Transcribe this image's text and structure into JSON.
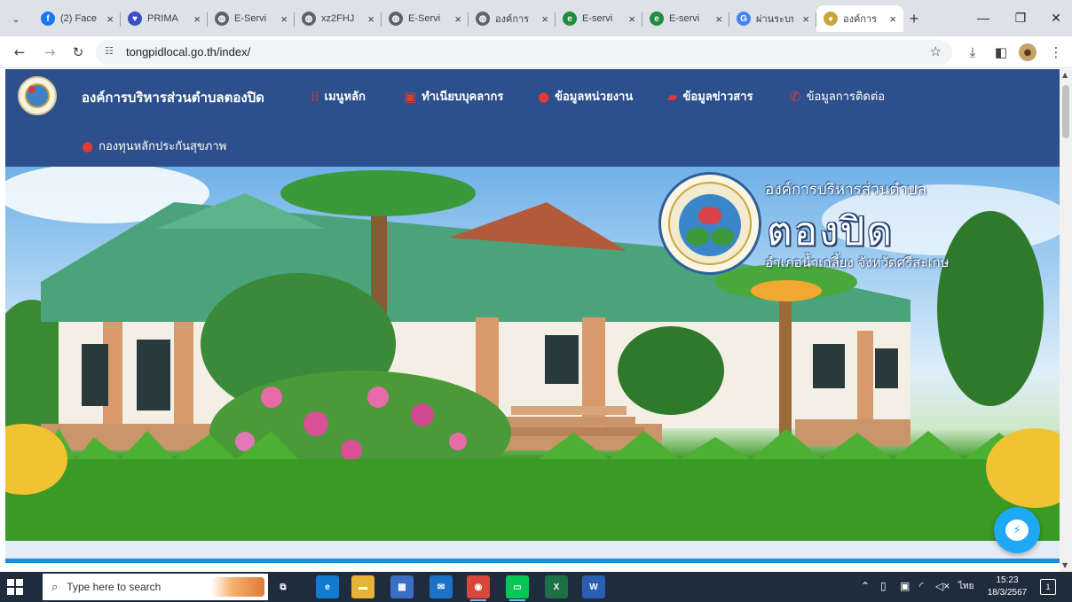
{
  "browser": {
    "tabs": [
      {
        "title": "(2) Face",
        "icon": "facebook-icon",
        "color": "#1877f2",
        "glyph": "f"
      },
      {
        "title": "PRIMA",
        "icon": "prima-icon",
        "color": "#3b4fc4",
        "glyph": "♥"
      },
      {
        "title": "E-Servi",
        "icon": "globe-icon",
        "color": "#5f6368",
        "glyph": "◍"
      },
      {
        "title": "xz2FHJ",
        "icon": "globe-icon",
        "color": "#5f6368",
        "glyph": "◍"
      },
      {
        "title": "E-Servi",
        "icon": "globe-icon",
        "color": "#5f6368",
        "glyph": "◍"
      },
      {
        "title": "องค์การ",
        "icon": "globe-icon",
        "color": "#5f6368",
        "glyph": "◍"
      },
      {
        "title": "E-servi",
        "icon": "eservice-icon",
        "color": "#1e8e3e",
        "glyph": "e"
      },
      {
        "title": "E-servi",
        "icon": "eservice-icon",
        "color": "#1e8e3e",
        "glyph": "e"
      },
      {
        "title": "ผ่านระบบ",
        "icon": "google-icon",
        "color": "#4285f4",
        "glyph": "G"
      },
      {
        "title": "องค์การ",
        "icon": "site-logo-icon",
        "color": "#c9a63d",
        "glyph": "●"
      }
    ],
    "tab_close": "×",
    "new_tab": "+",
    "url": "tongpidlocal.go.th/index/"
  },
  "site": {
    "name": "องค์การบริหารส่วนตำบลตองปิด",
    "menu": [
      {
        "label": "เมนูหลัก",
        "icon": "menu-grid-icon",
        "glyph": "⁞⁞"
      },
      {
        "label": "ทำเนียบบุคลากร",
        "icon": "calendar-icon",
        "glyph": "▣"
      },
      {
        "label": "ข้อมูลหน่วยงาน",
        "icon": "info-circle-icon",
        "glyph": "●"
      },
      {
        "label": "ข้อมูลข่าวสาร",
        "icon": "news-chat-icon",
        "glyph": "▰"
      },
      {
        "label": "ข้อมูลการติดต่อ",
        "icon": "phone-icon",
        "glyph": "✆"
      },
      {
        "label": "กองทุนหลักประกันสุขภาพ",
        "icon": "health-circle-icon",
        "glyph": "●"
      }
    ]
  },
  "hero": {
    "org_line": "องค์การบริหารส่วนตำบล",
    "name": "ตองปิด",
    "district": "อำเภอน้ำเกลี้ยง จังหวัดศรีสะเกษ"
  },
  "taskbar": {
    "search_placeholder": "Type here to search",
    "apps": [
      {
        "name": "task-view-icon",
        "glyph": "⧉",
        "color": "transparent"
      },
      {
        "name": "edge-icon",
        "glyph": "e",
        "color": "#0f7bd1"
      },
      {
        "name": "file-explorer-icon",
        "glyph": "▬",
        "color": "#e8b339"
      },
      {
        "name": "store-icon",
        "glyph": "▦",
        "color": "#3a6fc4"
      },
      {
        "name": "mail-icon",
        "glyph": "✉",
        "color": "#1a73c8"
      },
      {
        "name": "chrome-icon",
        "glyph": "◉",
        "color": "#d9463b"
      },
      {
        "name": "line-icon",
        "glyph": "▭",
        "color": "#06c755"
      },
      {
        "name": "excel-icon",
        "glyph": "X",
        "color": "#1d7044"
      },
      {
        "name": "word-icon",
        "glyph": "W",
        "color": "#2b5fb4"
      }
    ],
    "language": "ไทย",
    "time": "15:23",
    "date": "18/3/2567",
    "notification_count": "1"
  }
}
